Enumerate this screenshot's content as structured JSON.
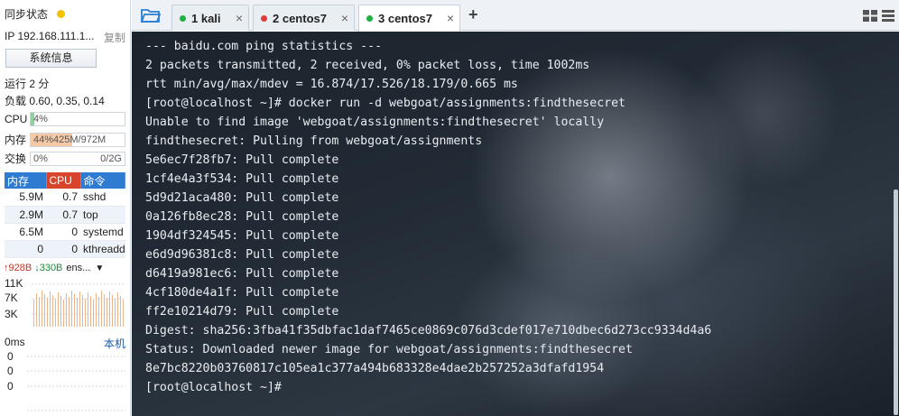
{
  "sidebar": {
    "sync_label": "同步状态",
    "ip": "IP 192.168.111.1...",
    "copy_label": "复制",
    "sysinfo_button": "系统信息",
    "runtime": "运行 2 分",
    "load": "负载 0.60, 0.35, 0.14",
    "cpu": {
      "label": "CPU",
      "value": "4%",
      "fraction": 0.04,
      "color": "#8fd19e"
    },
    "mem": {
      "label": "内存",
      "value": "44%425M/972M",
      "fraction": 0.44,
      "color": "#f6c9a6"
    },
    "swap": {
      "label": "交换",
      "value": "0%",
      "right": "0/2G",
      "fraction": 0.0
    },
    "proc_headers": [
      "内存",
      "CPU",
      "命令"
    ],
    "processes": [
      {
        "mem": "5.9M",
        "cpu": "0.7",
        "cmd": "sshd"
      },
      {
        "mem": "2.9M",
        "cpu": "0.7",
        "cmd": "top"
      },
      {
        "mem": "6.5M",
        "cpu": "0",
        "cmd": "systemd"
      },
      {
        "mem": "0",
        "cpu": "0",
        "cmd": "kthreadd"
      }
    ],
    "net": {
      "up": "↑928B",
      "down": "↓330B",
      "iface": "ens...",
      "axis": [
        "11K",
        "7K",
        "3K"
      ]
    },
    "latency": {
      "label": "0ms",
      "location": "本机",
      "axis": [
        "0",
        "0",
        "0"
      ]
    }
  },
  "tabs": [
    {
      "label": "1 kali",
      "status_color": "#1fb141",
      "close": "×"
    },
    {
      "label": "2 centos7",
      "status_color": "#e23b3b",
      "close": "×"
    },
    {
      "label": "3 centos7",
      "status_color": "#1fb141",
      "close": "×",
      "active": true
    }
  ],
  "tab_add": "+",
  "icons": {
    "folder": "folder-icon",
    "layout": "grid-layout-icon",
    "menu": "menu-icon"
  },
  "terminal": {
    "lines": [
      "--- baidu.com ping statistics ---",
      "2 packets transmitted, 2 received, 0% packet loss, time 1002ms",
      "rtt min/avg/max/mdev = 16.874/17.526/18.179/0.665 ms",
      "[root@localhost ~]# docker run -d webgoat/assignments:findthesecret",
      "Unable to find image 'webgoat/assignments:findthesecret' locally",
      "findthesecret: Pulling from webgoat/assignments",
      "5e6ec7f28fb7: Pull complete",
      "1cf4e4a3f534: Pull complete",
      "5d9d21aca480: Pull complete",
      "0a126fb8ec28: Pull complete",
      "1904df324545: Pull complete",
      "e6d9d96381c8: Pull complete",
      "d6419a981ec6: Pull complete",
      "4cf180de4a1f: Pull complete",
      "ff2e10214d79: Pull complete",
      "Digest: sha256:3fba41f35dbfac1daf7465ce0869c076d3cdef017e710dbec6d273cc9334d4a6",
      "Status: Downloaded newer image for webgoat/assignments:findthesecret",
      "8e7bc8220b03760817c105ea1c377a494b683328e4dae2b257252a3dfafd1954",
      "[root@localhost ~]#"
    ]
  }
}
